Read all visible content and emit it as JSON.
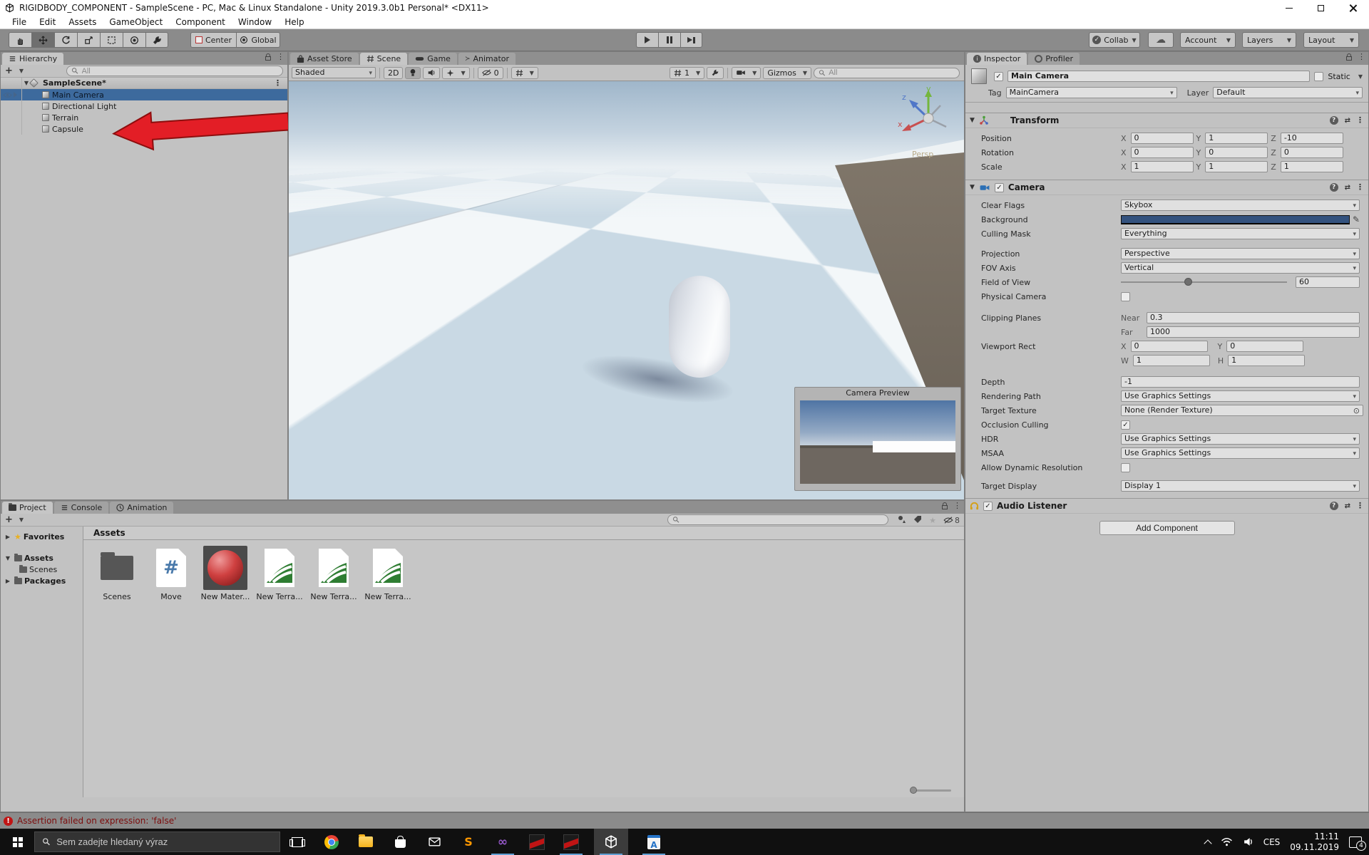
{
  "window": {
    "title": "RIGIDBODY_COMPONENT - SampleScene - PC, Mac & Linux Standalone - Unity 2019.3.0b1 Personal* <DX11>"
  },
  "menu": {
    "items": [
      "File",
      "Edit",
      "Assets",
      "GameObject",
      "Component",
      "Window",
      "Help"
    ]
  },
  "toolbar": {
    "center": "Center",
    "global": "Global",
    "collab": "Collab",
    "account": "Account",
    "layers": "Layers",
    "layout": "Layout"
  },
  "hierarchy": {
    "tab": "Hierarchy",
    "search_placeholder": "All",
    "scene_name": "SampleScene*",
    "items": [
      "Main Camera",
      "Directional Light",
      "Terrain",
      "Capsule"
    ]
  },
  "scene": {
    "tabs": [
      "Asset Store",
      "Scene",
      "Game",
      "Animator"
    ],
    "shading": "Shaded",
    "two_d": "2D",
    "hidden_count": "0",
    "grid_size": "1",
    "gizmos_label": "Gizmos",
    "search_placeholder": "All",
    "axis": {
      "x": "x",
      "y": "y",
      "z": "z",
      "persp": "Persp"
    },
    "camera_preview_title": "Camera Preview"
  },
  "inspector": {
    "tabs": [
      "Inspector",
      "Profiler"
    ],
    "name": "Main Camera",
    "static_label": "Static",
    "tag_label": "Tag",
    "tag_value": "MainCamera",
    "layer_label": "Layer",
    "layer_value": "Default",
    "transform": {
      "title": "Transform",
      "rows": [
        {
          "label": "Position",
          "x": "0",
          "y": "1",
          "z": "-10"
        },
        {
          "label": "Rotation",
          "x": "0",
          "y": "0",
          "z": "0"
        },
        {
          "label": "Scale",
          "x": "1",
          "y": "1",
          "z": "1"
        }
      ],
      "ax": "X",
      "ay": "Y",
      "az": "Z"
    },
    "camera": {
      "title": "Camera",
      "clear_flags_label": "Clear Flags",
      "clear_flags": "Skybox",
      "background_label": "Background",
      "background_color": "#33527e",
      "culling_mask_label": "Culling Mask",
      "culling_mask": "Everything",
      "projection_label": "Projection",
      "projection": "Perspective",
      "fov_axis_label": "FOV Axis",
      "fov_axis": "Vertical",
      "field_of_view_label": "Field of View",
      "field_of_view": "60",
      "physical_camera_label": "Physical Camera",
      "clipping_label": "Clipping Planes",
      "near_label": "Near",
      "near": "0.3",
      "far_label": "Far",
      "far": "1000",
      "viewport_label": "Viewport Rect",
      "vx_label": "X",
      "vx": "0",
      "vy_label": "Y",
      "vy": "0",
      "vw_label": "W",
      "vw": "1",
      "vh_label": "H",
      "vh": "1",
      "depth_label": "Depth",
      "depth": "-1",
      "rendering_path_label": "Rendering Path",
      "rendering_path": "Use Graphics Settings",
      "target_texture_label": "Target Texture",
      "target_texture": "None (Render Texture)",
      "occlusion_label": "Occlusion Culling",
      "hdr_label": "HDR",
      "hdr": "Use Graphics Settings",
      "msaa_label": "MSAA",
      "msaa": "Use Graphics Settings",
      "dynamic_res_label": "Allow Dynamic Resolution",
      "target_display_label": "Target Display",
      "target_display": "Display 1"
    },
    "audio_listener": {
      "title": "Audio Listener"
    },
    "add_component": "Add Component"
  },
  "project": {
    "tabs": [
      "Project",
      "Console",
      "Animation"
    ],
    "tree": {
      "favorites": "Favorites",
      "assets": "Assets",
      "scenes": "Scenes",
      "packages": "Packages"
    },
    "header": "Assets",
    "assets": [
      {
        "name": "Scenes"
      },
      {
        "name": "Move"
      },
      {
        "name": "New Mater..."
      },
      {
        "name": "New Terra..."
      },
      {
        "name": "New Terra..."
      },
      {
        "name": "New Terra..."
      }
    ],
    "hidden_count": "8"
  },
  "status_bar": {
    "message": "Assertion failed on expression: 'false'"
  },
  "taskbar": {
    "search_placeholder": "Sem zadejte hledaný výraz",
    "language": "CES",
    "time": "11:11",
    "date": "09.11.2019",
    "notification_count": "4"
  },
  "colors": {
    "selection_blue": "#3d6a9d",
    "arrow_red": "#e31e26",
    "camera_background": "#33527e"
  }
}
